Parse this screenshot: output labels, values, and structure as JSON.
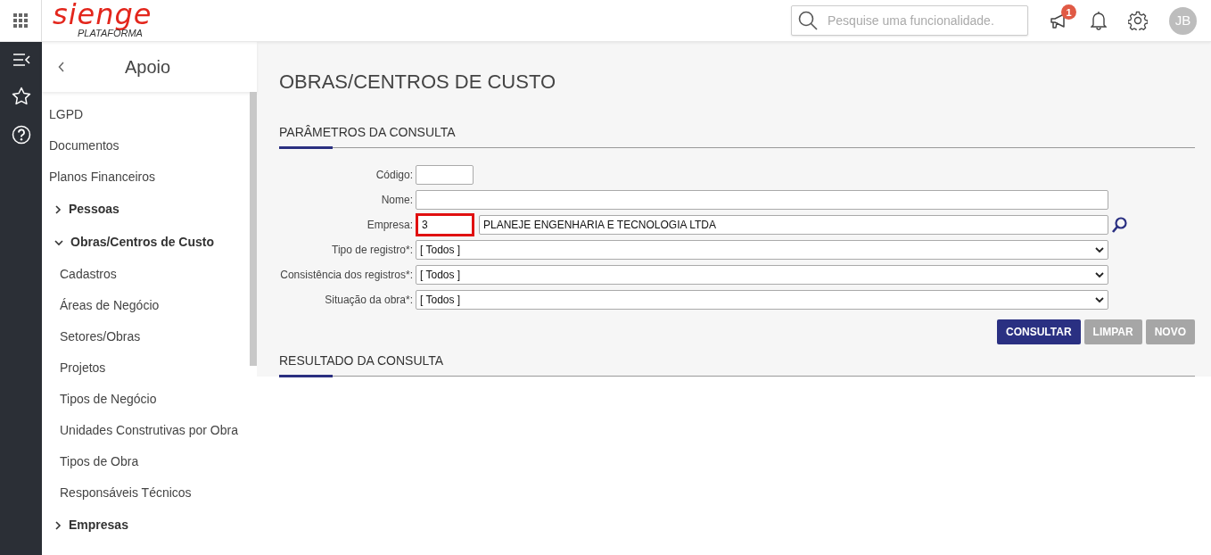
{
  "topbar": {
    "logo": "sienge",
    "logo_sub": "PLATAFORMA",
    "search": {
      "placeholder": "Pesquise uma funcionalidade."
    },
    "notification_count": "1",
    "avatar": "JB"
  },
  "sidebar": {
    "title": "Apoio",
    "items": [
      {
        "kind": "link",
        "label": "LGPD"
      },
      {
        "kind": "link",
        "label": "Documentos"
      },
      {
        "kind": "link",
        "label": "Planos Financeiros"
      },
      {
        "kind": "group",
        "label": "Pessoas",
        "expanded": false
      },
      {
        "kind": "group",
        "label": "Obras/Centros de Custo",
        "expanded": true,
        "children": [
          {
            "kind": "link",
            "label": "Cadastros"
          },
          {
            "kind": "link",
            "label": "Áreas de Negócio"
          },
          {
            "kind": "link",
            "label": "Setores/Obras"
          },
          {
            "kind": "link",
            "label": "Projetos"
          },
          {
            "kind": "link",
            "label": "Tipos de Negócio"
          },
          {
            "kind": "link",
            "label": "Unidades Construtivas por Obra"
          },
          {
            "kind": "link",
            "label": "Tipos de Obra"
          },
          {
            "kind": "link",
            "label": "Responsáveis Técnicos"
          }
        ]
      },
      {
        "kind": "group",
        "label": "Empresas",
        "expanded": false
      }
    ]
  },
  "page": {
    "title": "OBRAS/CENTROS DE CUSTO",
    "query_section": "PARÂMETROS DA CONSULTA",
    "fields": [
      {
        "kind": "short",
        "label": "Código:"
      },
      {
        "kind": "text",
        "label": "Nome:"
      },
      {
        "kind": "lookup",
        "label": "Empresa:",
        "value": "3",
        "description": "PLANEJE ENGENHARIA E TECNOLOGIA LTDA",
        "highlighted": true
      },
      {
        "kind": "select",
        "label": "Tipo de registro*:",
        "value": "[ Todos ]"
      },
      {
        "kind": "select",
        "label": "Consistência dos registros*:",
        "value": "[ Todos ]"
      },
      {
        "kind": "select",
        "label": "Situação da obra*:",
        "value": "[ Todos ]"
      }
    ],
    "buttons": [
      {
        "label": "CONSULTAR",
        "kind": "primary"
      },
      {
        "label": "LIMPAR",
        "kind": "secondary"
      },
      {
        "label": "NOVO",
        "kind": "secondary"
      }
    ],
    "result_section": "RESULTADO DA CONSULTA"
  }
}
